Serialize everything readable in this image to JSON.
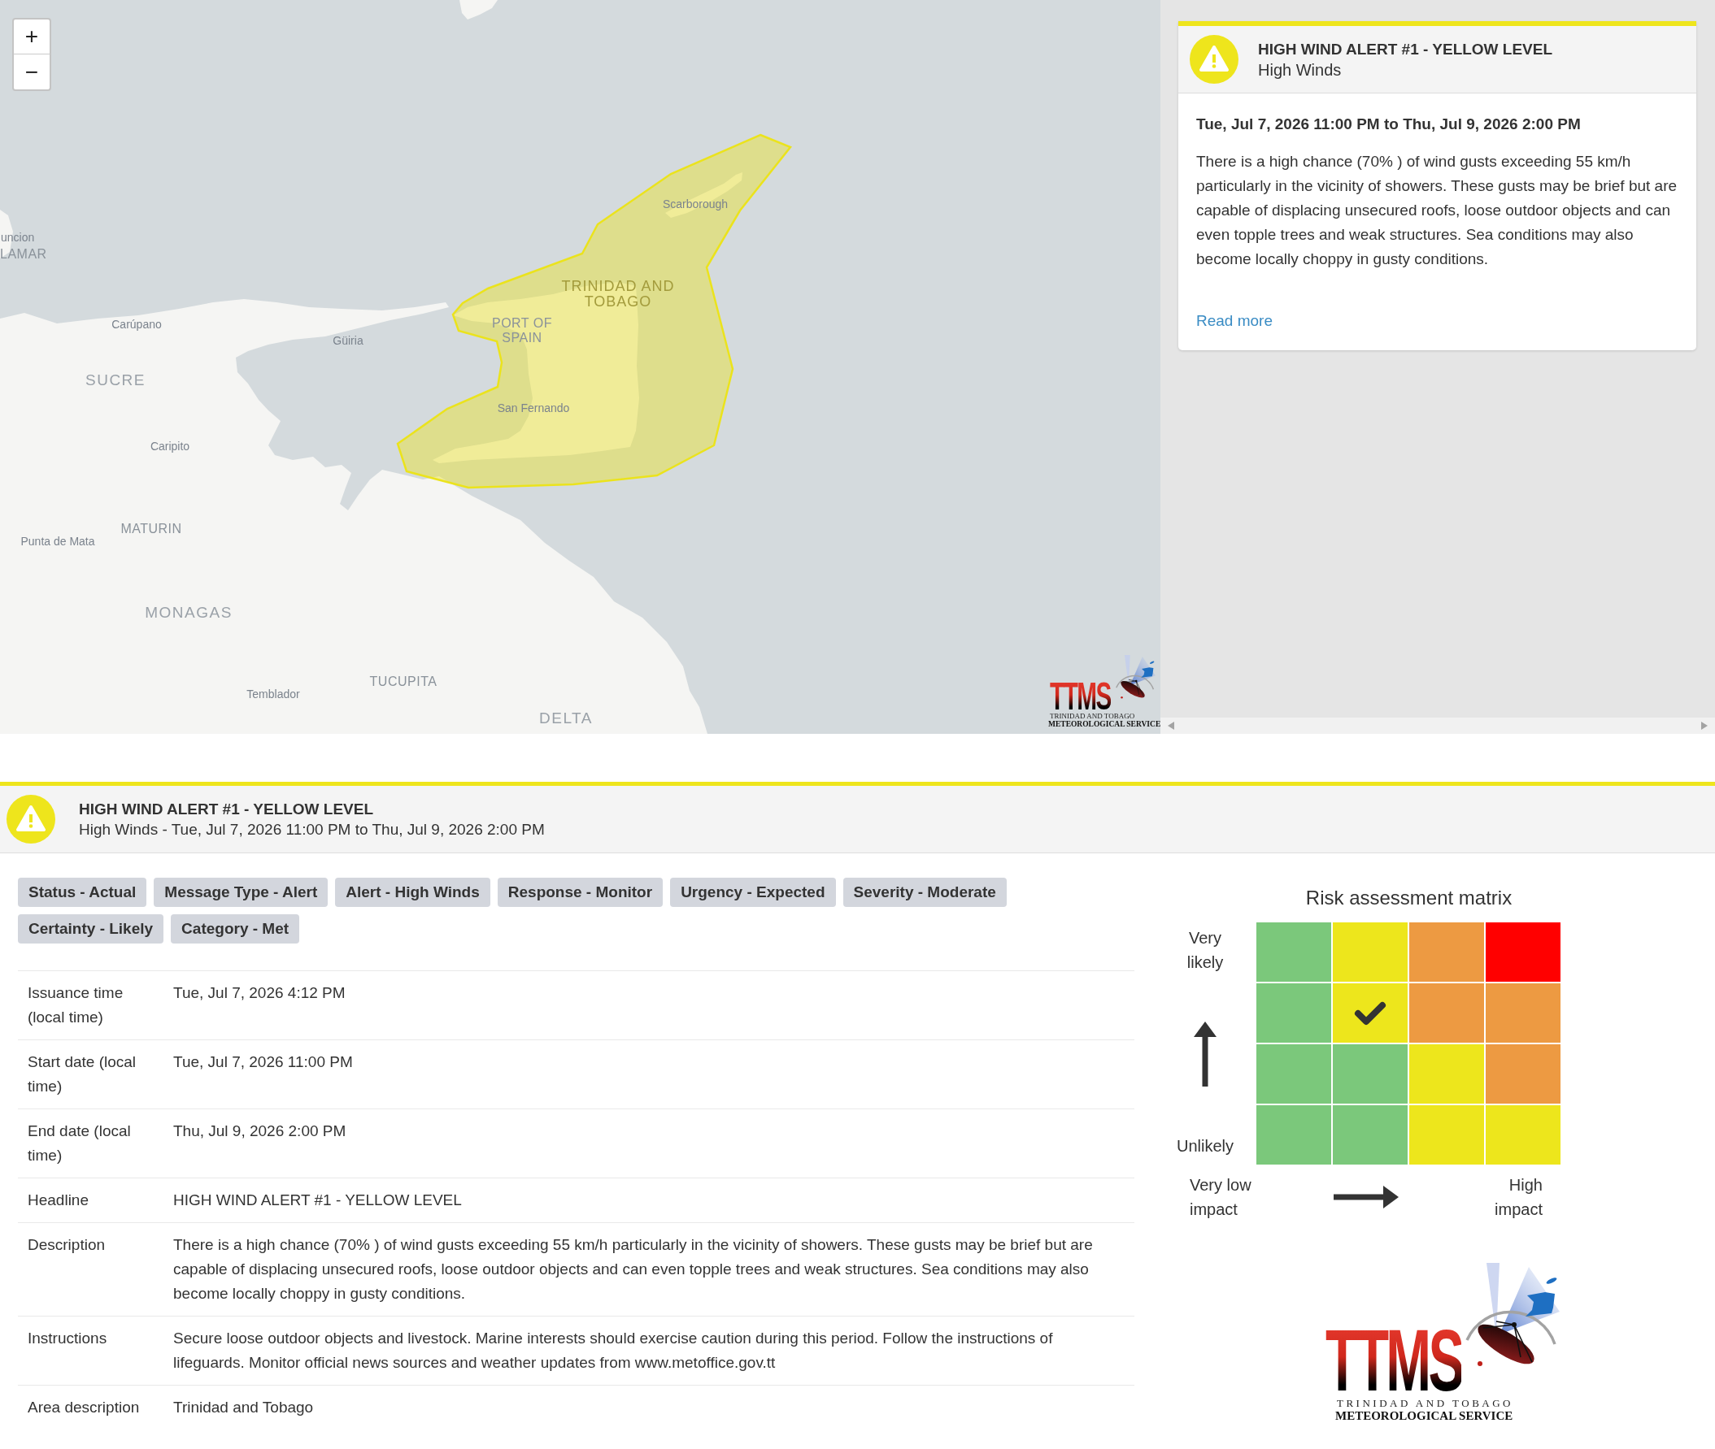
{
  "map": {
    "zoom_buttons": [
      "+",
      "−"
    ],
    "labels": [
      {
        "text": "uncion",
        "kind": "city"
      },
      {
        "text": "LAMAR",
        "kind": "district"
      },
      {
        "text": "Carúpano",
        "kind": "city"
      },
      {
        "text": "Güiria",
        "kind": "city"
      },
      {
        "text": "SUCRE",
        "kind": "region"
      },
      {
        "text": "Caripito",
        "kind": "city"
      },
      {
        "text": "MATURIN",
        "kind": "district"
      },
      {
        "text": "Punta de Mata",
        "kind": "city"
      },
      {
        "text": "MONAGAS",
        "kind": "region"
      },
      {
        "text": "Temblador",
        "kind": "city"
      },
      {
        "text": "TUCUPITA",
        "kind": "district"
      },
      {
        "text": "DELTA",
        "kind": "region"
      },
      {
        "text": "Scarborough",
        "kind": "city"
      },
      {
        "text": "TRINIDAD AND TOBAGO",
        "kind": "country"
      },
      {
        "text": "PORT OF SPAIN",
        "kind": "district"
      },
      {
        "text": "San Fernando",
        "kind": "city"
      }
    ],
    "logo": {
      "mark": "TTMS",
      "line_1": "TRINIDAD AND TOBAGO",
      "line_2": "METEOROLOGICAL SERVICE"
    }
  },
  "alert_card": {
    "title": "HIGH WIND ALERT #1 - YELLOW LEVEL",
    "subtitle": "High Winds",
    "period": "Tue, Jul 7, 2026 11:00 PM to Thu, Jul 9, 2026 2:00 PM",
    "description": "There is a high chance (70% ) of wind gusts exceeding 55 km/h particularly in the vicinity of showers. These gusts may be brief but are capable of displacing unsecured roofs, loose outdoor objects and can even topple trees and weak structures. Sea conditions may also become locally choppy in gusty conditions.",
    "link": "Read more"
  },
  "alert_header": {
    "title": "HIGH WIND ALERT #1 - YELLOW LEVEL",
    "subtitle": "High Winds - Tue, Jul 7, 2026 11:00 PM to Thu, Jul 9, 2026 2:00 PM"
  },
  "tags": [
    "Status - Actual",
    "Message Type - Alert",
    "Alert - High Winds",
    "Response - Monitor",
    "Urgency - Expected",
    "Severity - Moderate",
    "Certainty - Likely",
    "Category - Met"
  ],
  "details": [
    {
      "label": "Issuance time (local time)",
      "value": "Tue, Jul 7, 2026 4:12 PM"
    },
    {
      "label": "Start date (local time)",
      "value": "Tue, Jul 7, 2026 11:00 PM"
    },
    {
      "label": "End date (local time)",
      "value": "Thu, Jul 9, 2026 2:00 PM"
    },
    {
      "label": "Headline",
      "value": "HIGH WIND ALERT #1 - YELLOW LEVEL"
    },
    {
      "label": "Description",
      "value": "There is a high chance (70% ) of wind gusts exceeding 55 km/h particularly in the vicinity of showers. These gusts may be brief but are capable of displacing unsecured roofs, loose outdoor objects and can even topple trees and weak structures. Sea conditions may also become locally choppy in gusty conditions."
    },
    {
      "label": "Instructions",
      "value": "Secure loose outdoor objects and livestock. Marine interests should exercise caution during this period. Follow the instructions of lifeguards. Monitor official news sources and weather updates from www.metoffice.gov.tt"
    },
    {
      "label": "Area description",
      "value": "Trinidad and Tobago"
    }
  ],
  "risk_matrix": {
    "title": "Risk assessment matrix",
    "likelihood_top": "Very likely",
    "likelihood_bottom": "Unlikely",
    "impact_left": "Very low impact",
    "impact_right": "High impact",
    "rows": [
      {
        "cells": [
          {
            "color": "#7bc87b",
            "selected": false
          },
          {
            "color": "#ede61c",
            "selected": false
          },
          {
            "color": "#ed9a42",
            "selected": false
          },
          {
            "color": "#ff0000",
            "selected": false
          }
        ]
      },
      {
        "cells": [
          {
            "color": "#7bc87b",
            "selected": false
          },
          {
            "color": "#ede61c",
            "selected": true
          },
          {
            "color": "#ed9a42",
            "selected": false
          },
          {
            "color": "#ed9a42",
            "selected": false
          }
        ]
      },
      {
        "cells": [
          {
            "color": "#7bc87b",
            "selected": false
          },
          {
            "color": "#7bc87b",
            "selected": false
          },
          {
            "color": "#ede61c",
            "selected": false
          },
          {
            "color": "#ed9a42",
            "selected": false
          }
        ]
      },
      {
        "cells": [
          {
            "color": "#7bc87b",
            "selected": false
          },
          {
            "color": "#7bc87b",
            "selected": false
          },
          {
            "color": "#ede61c",
            "selected": false
          },
          {
            "color": "#ede61c",
            "selected": false
          }
        ]
      }
    ]
  },
  "logo": {
    "mark": "TTMS",
    "line_1": "TRINIDAD AND TOBAGO",
    "line_2": "METEOROLOGICAL SERVICE"
  }
}
